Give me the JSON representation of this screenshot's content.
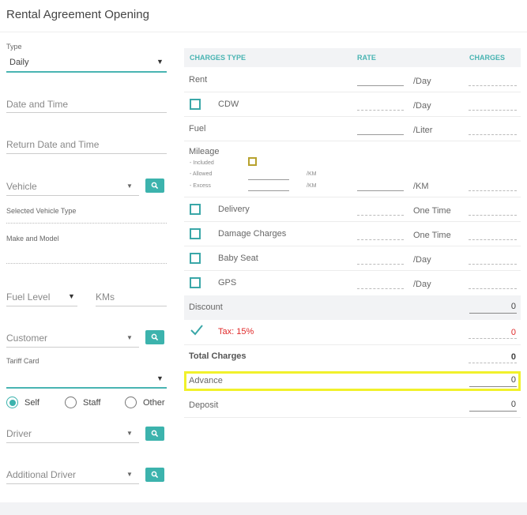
{
  "header": {
    "title": "Rental Agreement Opening"
  },
  "left": {
    "type_label": "Type",
    "type_value": "Daily",
    "date_time": "Date and Time",
    "return_date_time": "Return Date and Time",
    "vehicle": "Vehicle",
    "selected_vehicle_type": "Selected Vehicle Type",
    "make_model": "Make and Model",
    "fuel_level": "Fuel Level",
    "kms": "KMs",
    "customer": "Customer",
    "tariff_card": "Tariff Card",
    "radio": {
      "self": "Self",
      "staff": "Staff",
      "other": "Other",
      "selected": "Self"
    },
    "driver": "Driver",
    "additional_driver": "Additional Driver"
  },
  "charges": {
    "headers": {
      "type": "CHARGES TYPE",
      "rate": "RATE",
      "charges": "CHARGES"
    },
    "rent": {
      "label": "Rent",
      "unit": "/Day"
    },
    "cdw": {
      "label": "CDW",
      "unit": "/Day"
    },
    "fuel": {
      "label": "Fuel",
      "unit": "/Liter"
    },
    "mileage": {
      "label": "Mileage",
      "included": "- Included",
      "allowed": "- Allowed",
      "excess": "- Excess",
      "km1": "/KM",
      "km2": "/KM",
      "unit": "/KM"
    },
    "delivery": {
      "label": "Delivery",
      "unit": "One Time"
    },
    "damage": {
      "label": "Damage Charges",
      "unit": "One Time"
    },
    "baby_seat": {
      "label": "Baby Seat",
      "unit": "/Day"
    },
    "gps": {
      "label": "GPS",
      "unit": "/Day"
    },
    "discount": {
      "label": "Discount",
      "value": "0"
    },
    "tax": {
      "label": "Tax: 15%",
      "value": "0",
      "check": "✓"
    },
    "total": {
      "label": "Total Charges",
      "value": "0"
    },
    "advance": {
      "label": "Advance",
      "value": "0"
    },
    "deposit": {
      "label": "Deposit",
      "value": "0"
    }
  },
  "colors": {
    "accent": "#3cb3ad",
    "highlight": "#f1f12b",
    "tax_red": "#e02b2b"
  }
}
